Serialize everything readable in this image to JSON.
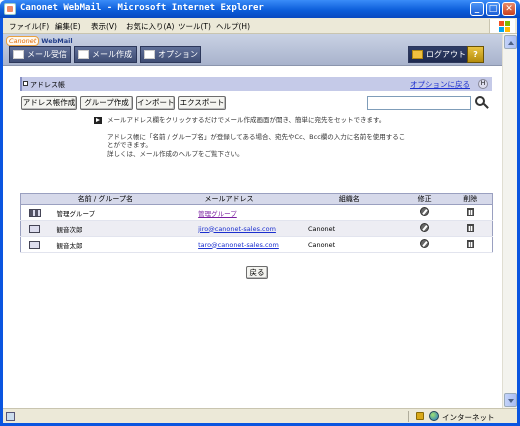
{
  "window": {
    "title": "Canonet WebMail - Microsoft Internet Explorer",
    "minimize": "_",
    "maximize": "□",
    "close": "✕"
  },
  "menubar": {
    "items": [
      "ファイル(F)",
      "編集(E)",
      "表示(V)",
      "お気に入り(A)",
      "ツール(T)",
      "ヘルプ(H)"
    ]
  },
  "app": {
    "logo_mark": "Canonet",
    "logo_text": "WebMail",
    "nav": {
      "receive": "メール受信",
      "compose": "メール作成",
      "options": "オプション",
      "logout": "ログアウト",
      "help": "?"
    }
  },
  "section": {
    "title": "アドレス帳",
    "back_link": "オプションに戻る",
    "help_icon": "H"
  },
  "toolbar": {
    "create_address": "アドレス帳作成",
    "create_group": "グループ作成",
    "import": "インポート",
    "export": "エクスポート"
  },
  "search": {
    "value": ""
  },
  "info": {
    "line1": "メールアドレス欄をクリックするだけでメール作成画面が開き、簡単に宛先をセットできます。",
    "line2": "アドレス帳に「名前 / グループ名」が登録してある場合、宛先やCc、Bcc欄の入力に名前を使用することができます。",
    "line3": "詳しくは、メール作成のヘルプをご覧下さい。"
  },
  "table": {
    "headers": {
      "type": "",
      "name": "名前 / グループ名",
      "email": "メールアドレス",
      "org": "組織名",
      "edit": "修正",
      "delete": "削除"
    },
    "rows": [
      {
        "kind": "group",
        "name": "管理グループ",
        "email": "管理グループ",
        "org": ""
      },
      {
        "kind": "person",
        "name": "観音次郎",
        "email": "jiro@canonet-sales.com",
        "org": "Canonet"
      },
      {
        "kind": "person",
        "name": "観音太郎",
        "email": "taro@canonet-sales.com",
        "org": "Canonet"
      }
    ]
  },
  "back_button": "戻る",
  "statusbar": {
    "zone": "インターネット"
  },
  "colors": {
    "title_bar": "#0a5bd8",
    "nav_button": "#3f4d74",
    "section_bar": "#c5cae8",
    "link": "#1b2fcf"
  }
}
